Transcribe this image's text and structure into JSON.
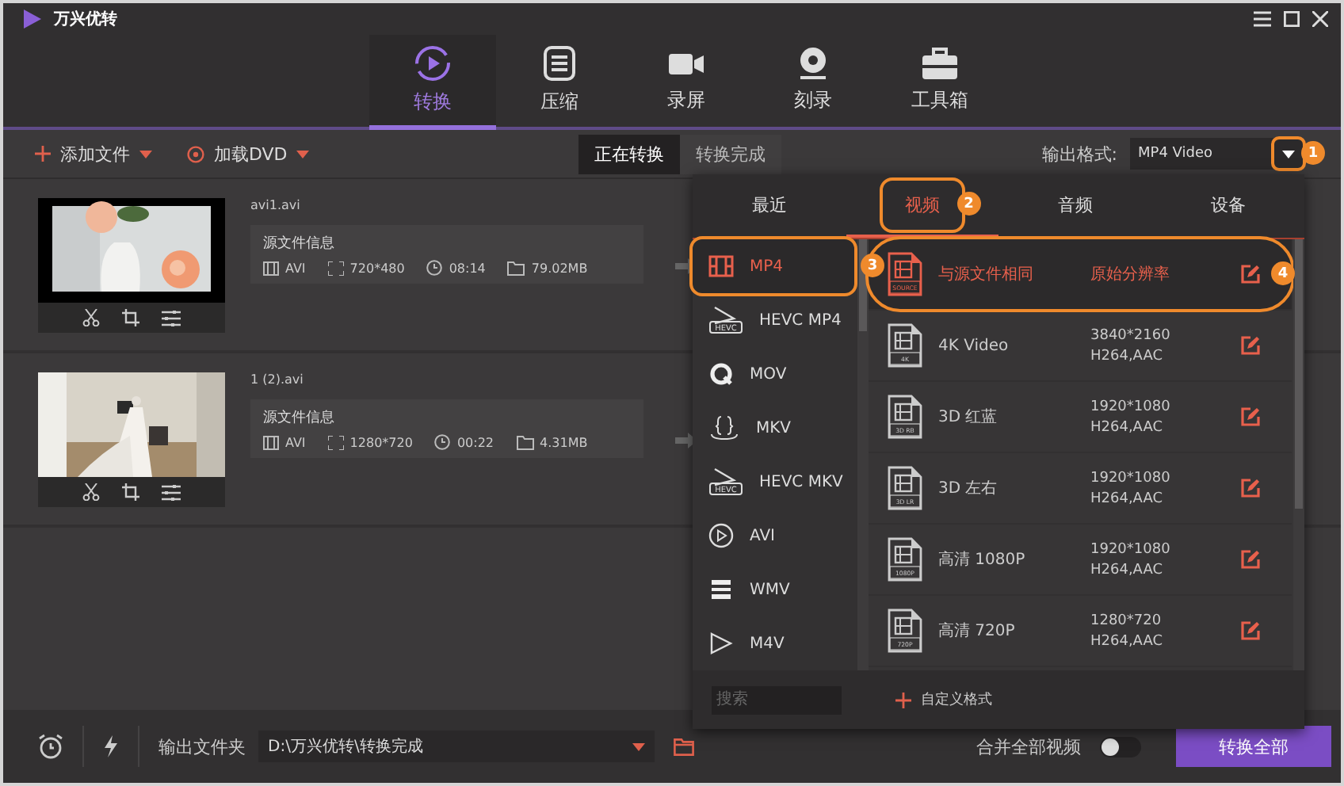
{
  "app": {
    "title": "万兴优转"
  },
  "nav_tabs": [
    {
      "label": "转换",
      "selected": true
    },
    {
      "label": "压缩",
      "selected": false
    },
    {
      "label": "录屏",
      "selected": false
    },
    {
      "label": "刻录",
      "selected": false
    },
    {
      "label": "工具箱",
      "selected": false
    }
  ],
  "toolbar": {
    "add_file": "添加文件",
    "load_dvd": "加载DVD",
    "status_tabs": [
      {
        "label": "正在转换",
        "selected": true
      },
      {
        "label": "转换完成",
        "selected": false
      }
    ],
    "output_format_label": "输出格式:",
    "output_format": {
      "value": "MP4 Video",
      "callout": "1"
    }
  },
  "files": [
    {
      "name": "avi1.avi",
      "info_title": "源文件信息",
      "format": "AVI",
      "resolution": "720*480",
      "duration": "08:14",
      "size": "79.02MB"
    },
    {
      "name": "1 (2).avi",
      "info_title": "源文件信息",
      "format": "AVI",
      "resolution": "1280*720",
      "duration": "00:22",
      "size": "4.31MB"
    }
  ],
  "format_panel": {
    "tabs": [
      {
        "label": "最近",
        "selected": false
      },
      {
        "label": "视频",
        "selected": true,
        "callout": "2"
      },
      {
        "label": "音频",
        "selected": false
      },
      {
        "label": "设备",
        "selected": false
      }
    ],
    "categories": [
      {
        "label": "MP4",
        "selected": true,
        "callout": "3"
      },
      {
        "label": "HEVC MP4",
        "selected": false,
        "icon_label": "HEVC"
      },
      {
        "label": "MOV",
        "selected": false
      },
      {
        "label": "MKV",
        "selected": false
      },
      {
        "label": "HEVC MKV",
        "selected": false,
        "icon_label": "HEVC"
      },
      {
        "label": "AVI",
        "selected": false
      },
      {
        "label": "WMV",
        "selected": false
      },
      {
        "label": "M4V",
        "selected": false
      }
    ],
    "presets": [
      {
        "name": "与源文件相同",
        "details": [
          "原始分辨率"
        ],
        "icon_label": "SOURCE",
        "selected": true,
        "callout": "4"
      },
      {
        "name": "4K Video",
        "details": [
          "3840*2160",
          "H264,AAC"
        ],
        "icon_label": "4K",
        "selected": false
      },
      {
        "name": "3D 红蓝",
        "details": [
          "1920*1080",
          "H264,AAC"
        ],
        "icon_label": "3D RB",
        "selected": false
      },
      {
        "name": "3D 左右",
        "details": [
          "1920*1080",
          "H264,AAC"
        ],
        "icon_label": "3D LR",
        "selected": false
      },
      {
        "name": "高清 1080P",
        "details": [
          "1920*1080",
          "H264,AAC"
        ],
        "icon_label": "1080P",
        "selected": false
      },
      {
        "name": "高清 720P",
        "details": [
          "1280*720",
          "H264,AAC"
        ],
        "icon_label": "720P",
        "selected": false
      }
    ],
    "search_placeholder": "搜索",
    "custom_format": "自定义格式"
  },
  "bottom_bar": {
    "output_folder_label": "输出文件夹",
    "output_folder": "D:\\万兴优转\\转换完成",
    "merge_label": "合并全部视频",
    "merge_on": false,
    "convert_all": "转换全部"
  }
}
